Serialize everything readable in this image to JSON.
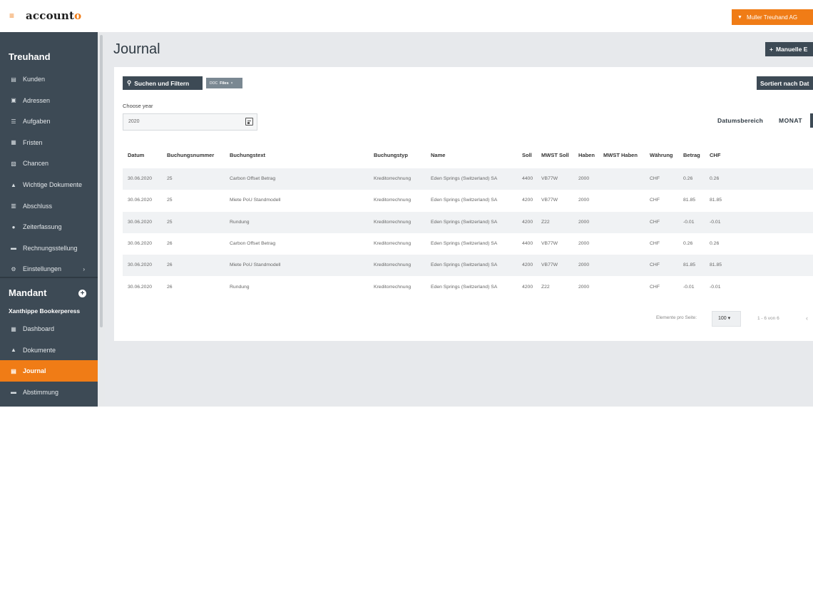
{
  "app": {
    "logo_main": "account",
    "logo_accent": "o",
    "org_button": "Muller Treuhand AG",
    "hamburger_icon": "menu-icon"
  },
  "sidebar": {
    "section1": "Treuhand",
    "items": [
      {
        "label": "Kunden",
        "icon": "building-icon"
      },
      {
        "label": "Adressen",
        "icon": "address-book-icon"
      },
      {
        "label": "Aufgaben",
        "icon": "list-icon"
      },
      {
        "label": "Fristen",
        "icon": "calendar-icon"
      },
      {
        "label": "Chancen",
        "icon": "chart-icon"
      },
      {
        "label": "Wichtige Dokumente",
        "icon": "folder-icon"
      },
      {
        "label": "Abschluss",
        "icon": "document-icon"
      },
      {
        "label": "Zeiterfassung",
        "icon": "clock-icon"
      },
      {
        "label": "Rechnungsstellung",
        "icon": "invoice-icon"
      },
      {
        "label": "Einstellungen",
        "icon": "gear-icon"
      }
    ],
    "section2": "Mandant",
    "client_name": "Xanthippe Bookerperess",
    "client_items": [
      {
        "label": "Dashboard",
        "icon": "grid-icon"
      },
      {
        "label": "Dokumente",
        "icon": "folder-icon"
      },
      {
        "label": "Journal",
        "icon": "journal-icon",
        "active": true
      },
      {
        "label": "Abstimmung",
        "icon": "reconcile-icon"
      }
    ]
  },
  "main": {
    "title": "Journal",
    "manual_button": "Manuelle E",
    "search_button": "Suchen und Filtern",
    "filter_chip_prefix": "DOC",
    "filter_chip_value": "Files",
    "sort_button": "Sortiert nach Dat",
    "year_label": "Choose year",
    "year_value": "2020",
    "date_range_label": "Datumsbereich",
    "monat_label": "MONAT"
  },
  "table": {
    "headers": [
      "Datum",
      "Buchungsnummer",
      "Buchungstext",
      "Buchungstyp",
      "Name",
      "Soll",
      "MWST Soll",
      "Haben",
      "MWST Haben",
      "Währung",
      "Betrag",
      "CHF"
    ],
    "rows": [
      [
        "30.06.2020",
        "25",
        "Carbon Offset Betrag",
        "Kreditorrechnung",
        "Eden Springs (Switzerland) SA",
        "4400",
        "VB77W",
        "2000",
        "",
        "CHF",
        "0.26",
        "0.26"
      ],
      [
        "30.06.2020",
        "25",
        "Miete PoU Standmodell",
        "Kreditorrechnung",
        "Eden Springs (Switzerland) SA",
        "4200",
        "VB77W",
        "2000",
        "",
        "CHF",
        "81.85",
        "81.85"
      ],
      [
        "30.06.2020",
        "25",
        "Rundung",
        "Kreditorrechnung",
        "Eden Springs (Switzerland) SA",
        "4200",
        "Z22",
        "2000",
        "",
        "CHF",
        "-0.01",
        "-0.01"
      ],
      [
        "30.06.2020",
        "26",
        "Carbon Offset Betrag",
        "Kreditorrechnung",
        "Eden Springs (Switzerland) SA",
        "4400",
        "VB77W",
        "2000",
        "",
        "CHF",
        "0.26",
        "0.26"
      ],
      [
        "30.06.2020",
        "26",
        "Miete PoU Standmodell",
        "Kreditorrechnung",
        "Eden Springs (Switzerland) SA",
        "4200",
        "VB77W",
        "2000",
        "",
        "CHF",
        "81.85",
        "81.85"
      ],
      [
        "30.06.2020",
        "26",
        "Rundung",
        "Kreditorrechnung",
        "Eden Springs (Switzerland) SA",
        "4200",
        "Z22",
        "2000",
        "",
        "CHF",
        "-0.01",
        "-0.01"
      ]
    ]
  },
  "pagination": {
    "per_page_label": "Elemente pro Seite:",
    "per_page_value": "100",
    "range": "1 - 6 von 6"
  },
  "colors": {
    "accent": "#f07c16",
    "sidebar": "#3d4a55",
    "background": "#e7e9ec"
  }
}
